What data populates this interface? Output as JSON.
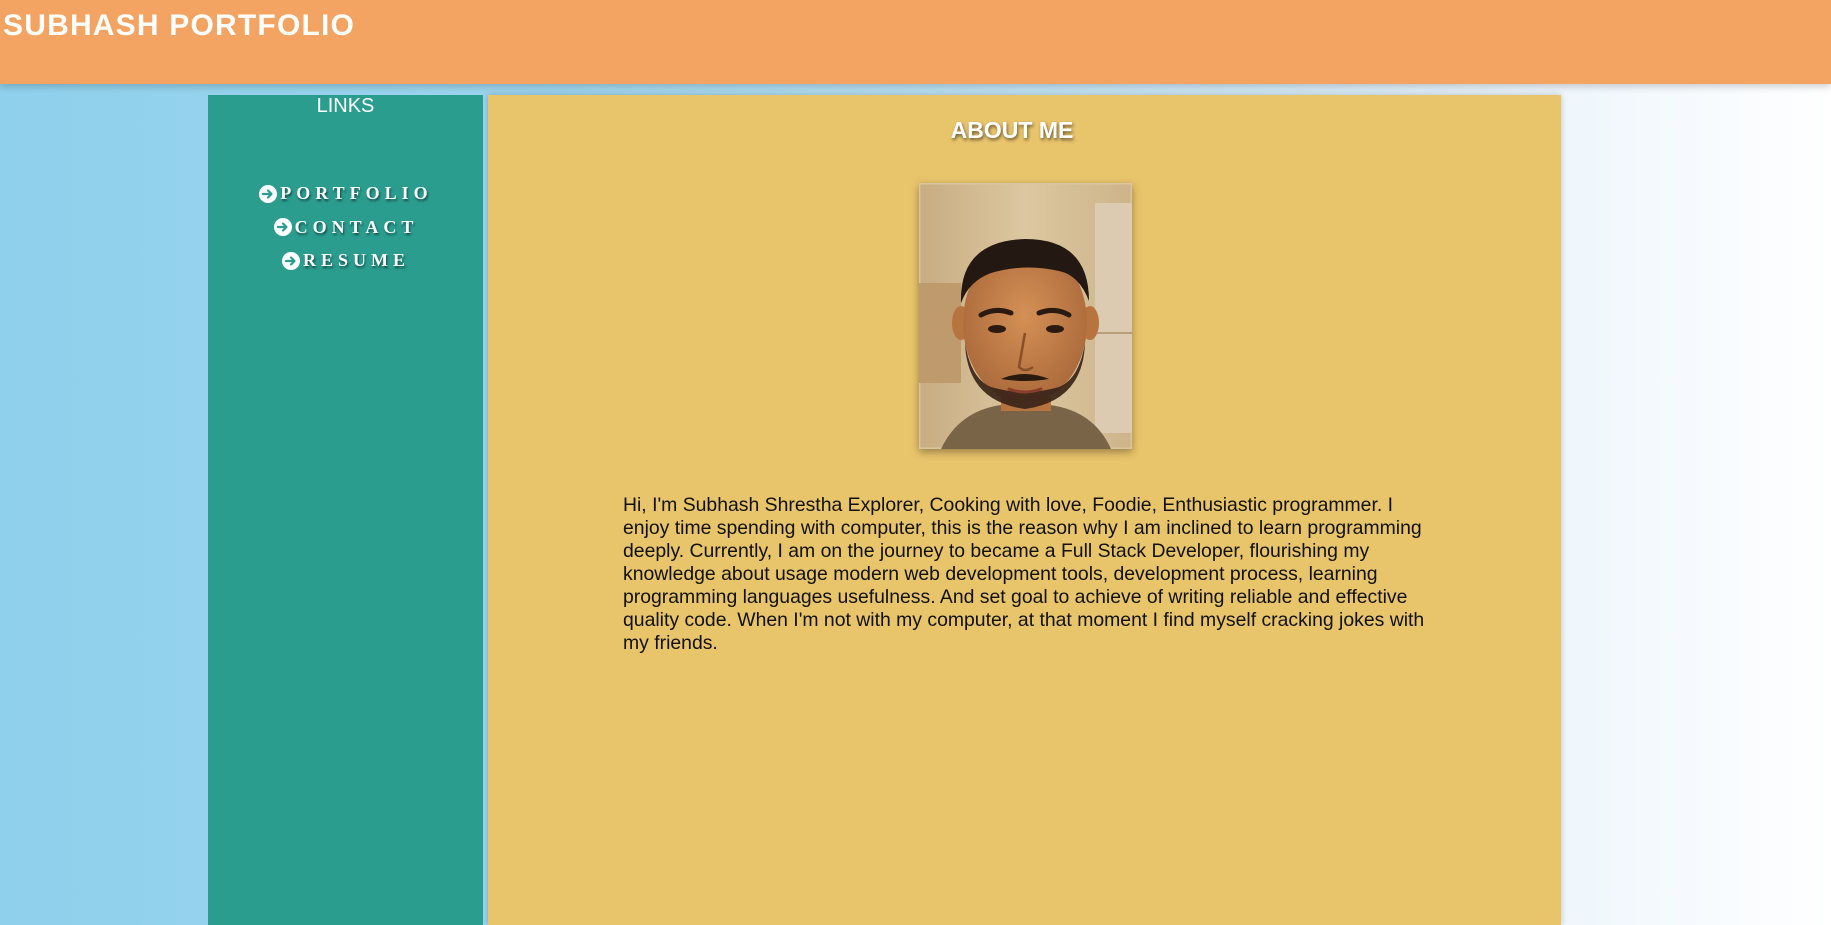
{
  "header": {
    "title": "SUBHASH PORTFOLIO"
  },
  "sidebar": {
    "heading": "LINKS",
    "items": [
      {
        "label": "PORTFOLIO",
        "icon": "arrow-circle-right-icon"
      },
      {
        "label": "CONTACT",
        "icon": "arrow-circle-right-icon"
      },
      {
        "label": "RESUME",
        "icon": "arrow-circle-right-icon"
      }
    ]
  },
  "main": {
    "title": "ABOUT ME",
    "photo_alt": "profile photo",
    "bio": "Hi, I'm Subhash Shrestha Explorer, Cooking with love, Foodie, Enthusiastic programmer. I enjoy time spending with computer, this is the reason why I am inclined to learn programming deeply. Currently, I am on the journey to became a Full Stack Developer, flourishing my knowledge about usage modern web development tools, development process, learning programming languages usefulness. And set goal to achieve of writing reliable and effective quality code. When I'm not with my computer, at that moment I find myself cracking jokes with my friends."
  },
  "colors": {
    "header": "#f4a462",
    "sidebar": "#2a9d8f",
    "main": "#e8c46b",
    "background_left": "#8fd0ec",
    "background_right": "#ffffff"
  }
}
